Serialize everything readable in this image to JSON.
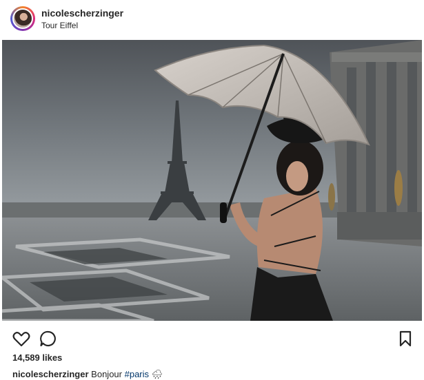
{
  "post": {
    "username": "nicolescherzinger",
    "location": "Tour Eiffel",
    "likes": "14,589 likes",
    "caption": {
      "user": "nicolescherzinger",
      "text": "Bonjour",
      "hashtag": "#paris",
      "emoji": "🌧"
    }
  },
  "icons": {
    "like": "heart-icon",
    "comment": "comment-icon",
    "save": "bookmark-icon"
  }
}
